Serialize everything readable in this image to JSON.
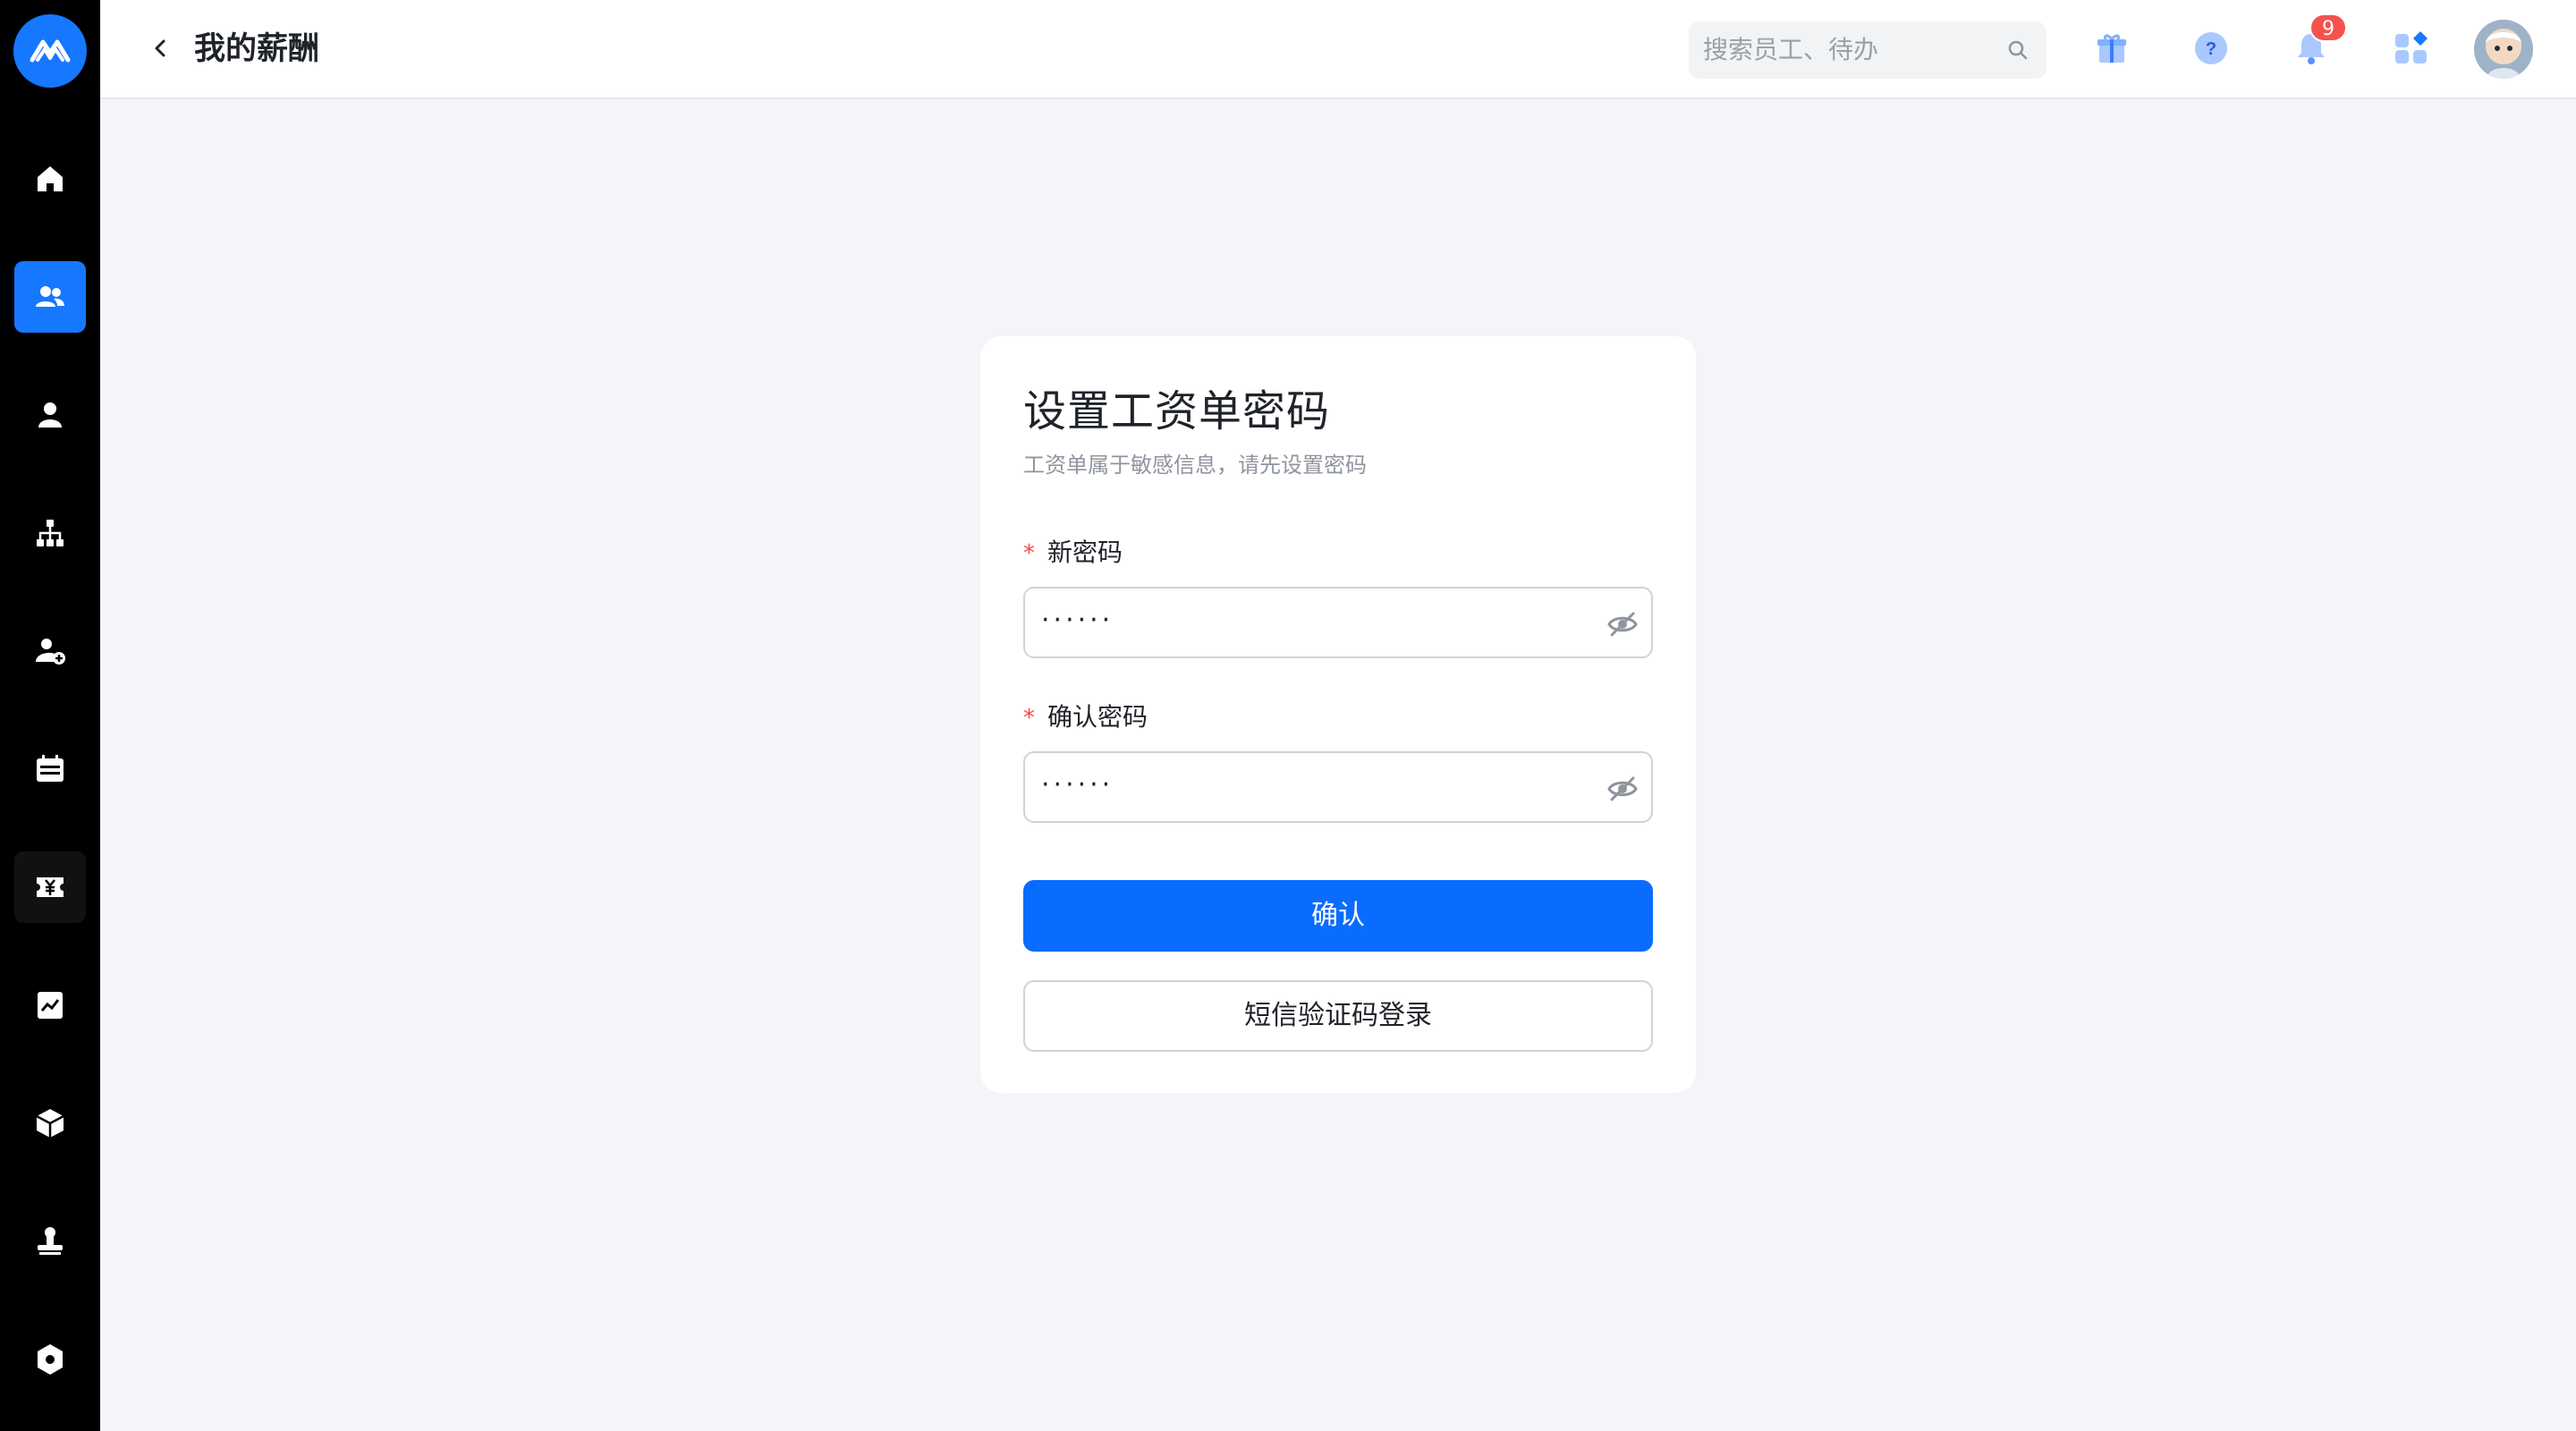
{
  "header": {
    "title": "我的薪酬",
    "search_placeholder": "搜索员工、待办",
    "notification_count": "9"
  },
  "sidebar": {
    "items": [
      {
        "icon": "home-icon",
        "active": false
      },
      {
        "icon": "people-icon",
        "active": true
      },
      {
        "icon": "person-icon",
        "active": false
      },
      {
        "icon": "org-chart-icon",
        "active": false
      },
      {
        "icon": "add-person-icon",
        "active": false
      },
      {
        "icon": "calendar-icon",
        "active": false
      },
      {
        "icon": "salary-icon",
        "active": false
      },
      {
        "icon": "report-icon",
        "active": false
      },
      {
        "icon": "box-icon",
        "active": false
      },
      {
        "icon": "stamp-icon",
        "active": false
      },
      {
        "icon": "settings-icon",
        "active": false
      }
    ]
  },
  "form": {
    "title": "设置工资单密码",
    "subtitle": "工资单属于敏感信息，请先设置密码",
    "required_mark": "*",
    "new_password_label": "新密码",
    "new_password_value": "······",
    "confirm_password_label": "确认密码",
    "confirm_password_value": "······",
    "confirm_button": "确认",
    "sms_login_button": "短信验证码登录"
  },
  "colors": {
    "accent": "#0a6cff",
    "sidebar_bg": "#000000",
    "required": "#f54a45",
    "badge": "#f5524d",
    "page_bg": "#f4f5f9"
  }
}
